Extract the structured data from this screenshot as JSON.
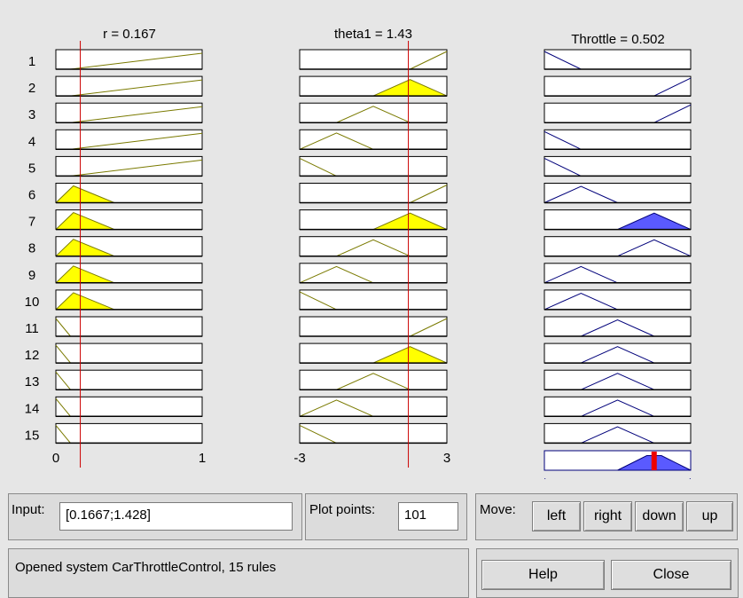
{
  "rule_viewer": {
    "input_vars": [
      {
        "title": "r = 0.167",
        "range_min": 0,
        "range_max": 1,
        "tick_min_label": "0",
        "tick_max_label": "1",
        "current": 0.167
      },
      {
        "title": "theta1 = 1.43",
        "range_min": -3,
        "range_max": 3,
        "tick_min_label": "-3",
        "tick_max_label": "3",
        "current": 1.43
      }
    ],
    "output_var": {
      "title": "Throttle = 0.502",
      "range_min": 0,
      "range_max": 1,
      "current": 0.502
    },
    "rules": [
      "1",
      "2",
      "3",
      "4",
      "5",
      "6",
      "7",
      "8",
      "9",
      "10",
      "11",
      "12",
      "13",
      "14",
      "15"
    ],
    "colors": {
      "input_line": "#7a7a00",
      "input_fill": "#ffff00",
      "output_line": "#00007a",
      "output_fill": "#5a5aff",
      "crosshair": "#cc0000"
    }
  },
  "input_panel": {
    "label": "Input:",
    "value": "[0.1667;1.428]"
  },
  "plot_points_panel": {
    "label": "Plot points:",
    "value": "101"
  },
  "move_panel": {
    "label": "Move:",
    "left": "left",
    "right": "right",
    "down": "down",
    "up": "up"
  },
  "status": {
    "text": "Opened system CarThrottleControl, 15 rules"
  },
  "buttons": {
    "help": "Help",
    "close": "Close"
  }
}
